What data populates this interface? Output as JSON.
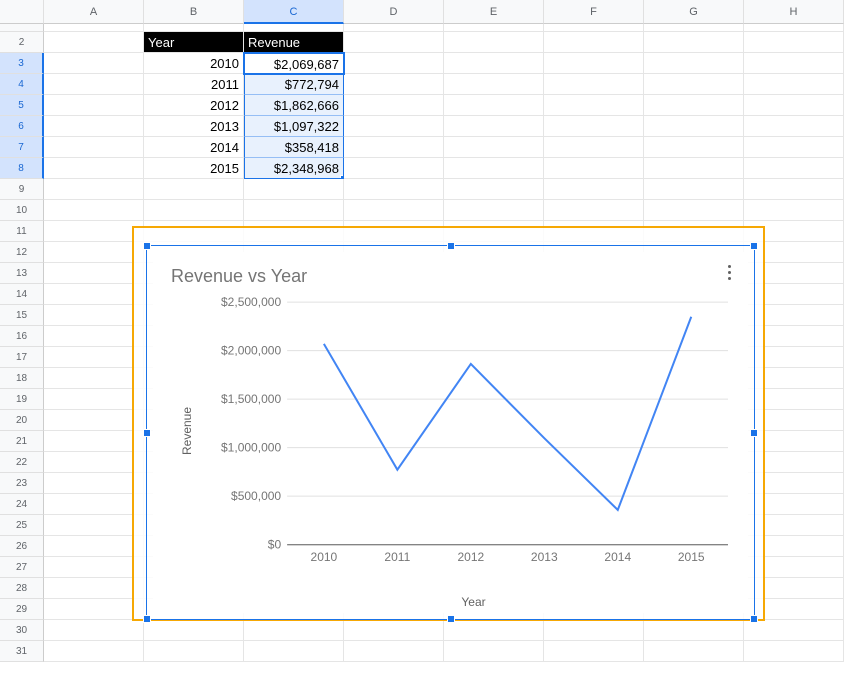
{
  "columns": [
    "A",
    "B",
    "C",
    "D",
    "E",
    "F",
    "G",
    "H"
  ],
  "rows": 31,
  "selected_col": "C",
  "selected_rows": [
    3,
    4,
    5,
    6,
    7,
    8
  ],
  "table": {
    "header_year": "Year",
    "header_revenue": "Revenue",
    "rows": [
      {
        "year": "2010",
        "revenue": "$2,069,687"
      },
      {
        "year": "2011",
        "revenue": "$772,794"
      },
      {
        "year": "2012",
        "revenue": "$1,862,666"
      },
      {
        "year": "2013",
        "revenue": "$1,097,322"
      },
      {
        "year": "2014",
        "revenue": "$358,418"
      },
      {
        "year": "2015",
        "revenue": "$2,348,968"
      }
    ]
  },
  "chart_data": {
    "type": "line",
    "title": "Revenue vs Year",
    "xlabel": "Year",
    "ylabel": "Revenue",
    "categories": [
      "2010",
      "2011",
      "2012",
      "2013",
      "2014",
      "2015"
    ],
    "values": [
      2069687,
      772794,
      1862666,
      1097322,
      358418,
      2348968
    ],
    "ylim": [
      0,
      2500000
    ],
    "yticks": [
      0,
      500000,
      1000000,
      1500000,
      2000000,
      2500000
    ],
    "ytick_labels": [
      "$0",
      "$500,000",
      "$1,000,000",
      "$1,500,000",
      "$2,000,000",
      "$2,500,000"
    ]
  }
}
